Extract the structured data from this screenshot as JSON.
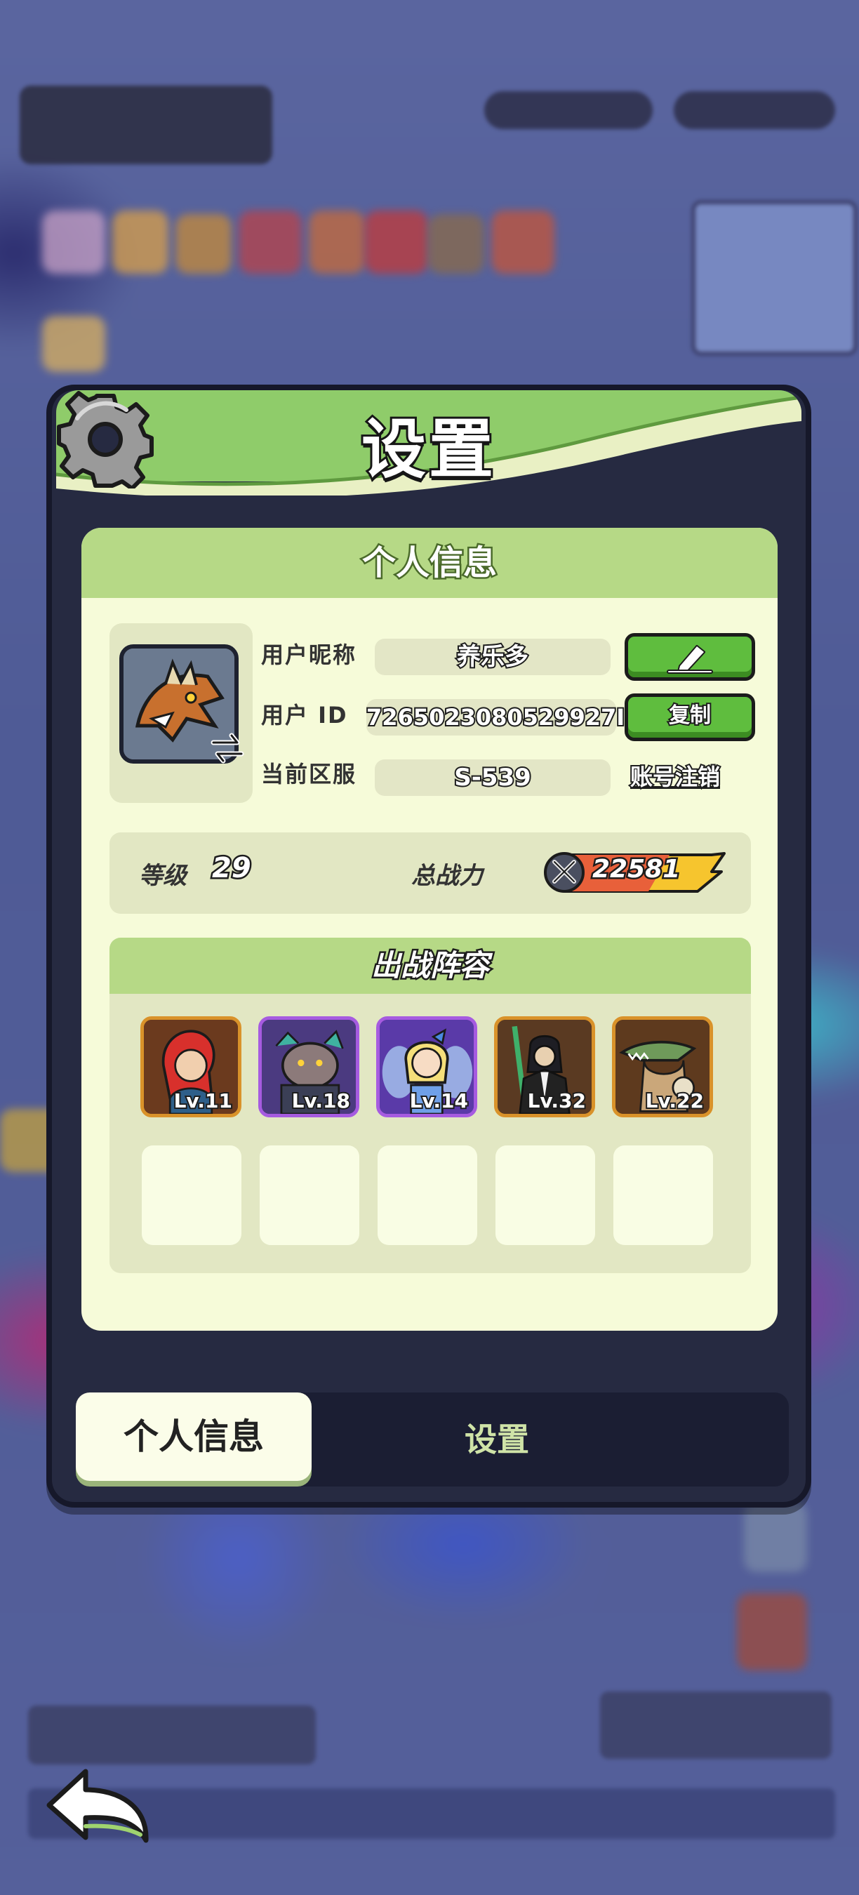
{
  "dialog": {
    "title": "设置",
    "card_header": "个人信息"
  },
  "profile": {
    "nickname_label": "用户昵称",
    "nickname": "养乐多",
    "edit_icon": "pencil-icon",
    "id_label": "用户 ID",
    "user_id": "7265023080529927I",
    "copy_label": "复制",
    "server_label": "当前区服",
    "server": "S-539",
    "cancel_account_label": "账号注销"
  },
  "stats": {
    "level_label": "等级",
    "level": "29",
    "power_label": "总战力",
    "power": "22581"
  },
  "lineup": {
    "title": "出战阵容",
    "heroes": [
      {
        "level": "Lv.11",
        "frame": "gold"
      },
      {
        "level": "Lv.18",
        "frame": "purple"
      },
      {
        "level": "Lv.14",
        "frame": "purple"
      },
      {
        "level": "Lv.32",
        "frame": "gold"
      },
      {
        "level": "Lv.22",
        "frame": "gold"
      }
    ],
    "empty_slots": 5
  },
  "tabs": [
    {
      "label": "个人信息",
      "active": true
    },
    {
      "label": "设置",
      "active": false
    }
  ],
  "colors": {
    "header_green": "#b6d986",
    "button_green": "#5fbd3e",
    "card_bg": "#f6fbd9",
    "dialog_bg": "#262a41"
  }
}
